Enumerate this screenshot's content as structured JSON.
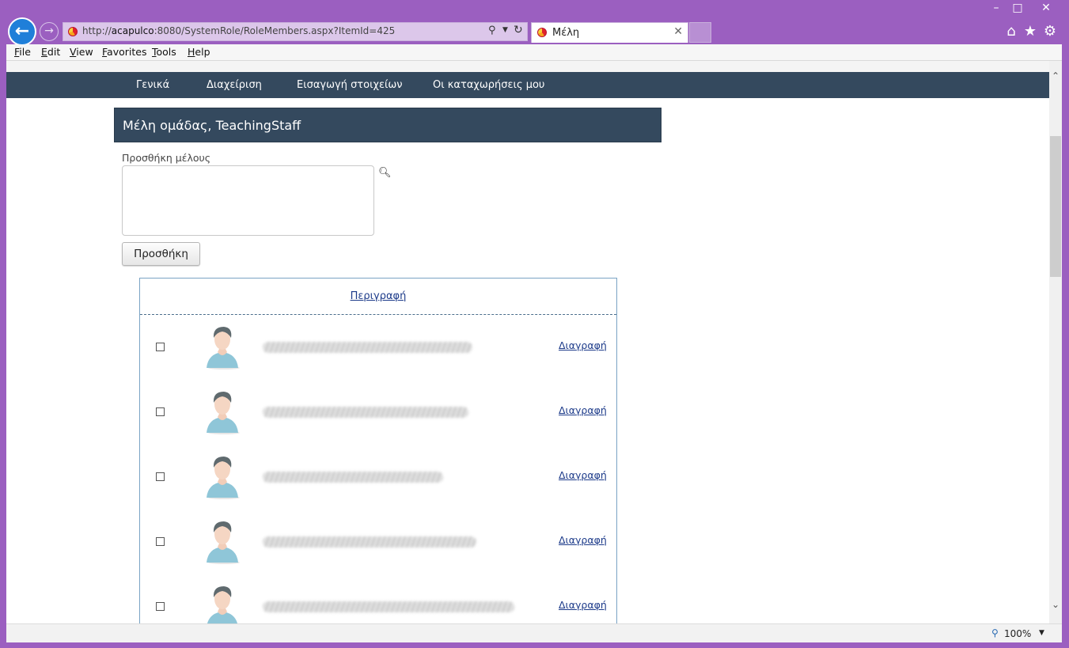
{
  "browser": {
    "address": {
      "prefix": "http://",
      "host": "acapulco",
      "rest": ":8080/SystemRole/RoleMembers.aspx?ItemId=425"
    },
    "tab_title": "Μέλη",
    "zoom": "100%"
  },
  "menu": [
    "File",
    "Edit",
    "View",
    "Favorites",
    "Tools",
    "Help"
  ],
  "nav": [
    "Γενικά",
    "Διαχείριση",
    "Εισαγωγή στοιχείων",
    "Οι καταχωρήσεις μου"
  ],
  "panel": {
    "title": "Μέλη ομάδας, TeachingStaff"
  },
  "form": {
    "add_member_label": "Προσθήκη μέλους",
    "add_button": "Προσθήκη"
  },
  "table": {
    "header_description": "Περιγραφή",
    "rows": [
      {
        "delete": "Διαγραφή"
      },
      {
        "delete": "Διαγραφή"
      },
      {
        "delete": "Διαγραφή"
      },
      {
        "delete": "Διαγραφή"
      },
      {
        "delete": "Διαγραφή"
      }
    ]
  },
  "colors": {
    "navbar": "#34495e",
    "chrome": "#9b5fc0",
    "link": "#1d3b8a"
  }
}
